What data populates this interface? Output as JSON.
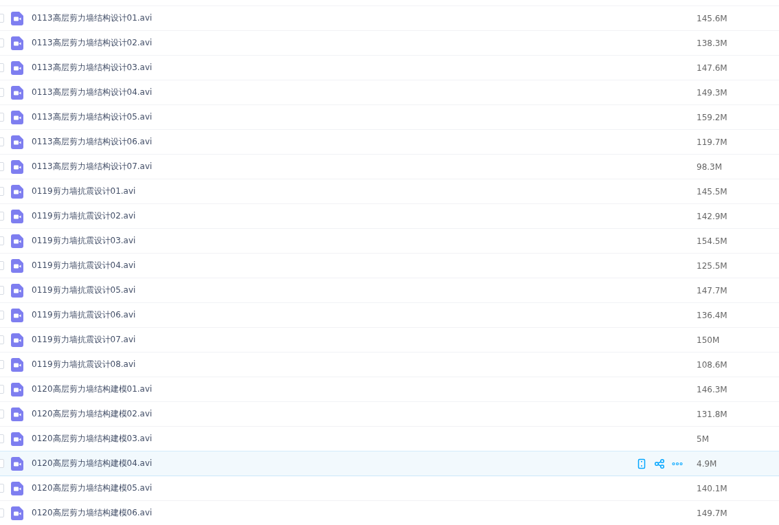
{
  "files": [
    {
      "name": "0113高层剪力墙结构设计01.avi",
      "size": "145.6M",
      "checked": false,
      "hovered": false
    },
    {
      "name": "0113高层剪力墙结构设计02.avi",
      "size": "138.3M",
      "checked": false,
      "hovered": false
    },
    {
      "name": "0113高层剪力墙结构设计03.avi",
      "size": "147.6M",
      "checked": false,
      "hovered": false
    },
    {
      "name": "0113高层剪力墙结构设计04.avi",
      "size": "149.3M",
      "checked": false,
      "hovered": false
    },
    {
      "name": "0113高层剪力墙结构设计05.avi",
      "size": "159.2M",
      "checked": false,
      "hovered": false
    },
    {
      "name": "0113高层剪力墙结构设计06.avi",
      "size": "119.7M",
      "checked": false,
      "hovered": false
    },
    {
      "name": "0113高层剪力墙结构设计07.avi",
      "size": "98.3M",
      "checked": false,
      "hovered": false
    },
    {
      "name": "0119剪力墙抗震设计01.avi",
      "size": "145.5M",
      "checked": false,
      "hovered": false
    },
    {
      "name": "0119剪力墙抗震设计02.avi",
      "size": "142.9M",
      "checked": false,
      "hovered": false
    },
    {
      "name": "0119剪力墙抗震设计03.avi",
      "size": "154.5M",
      "checked": false,
      "hovered": false
    },
    {
      "name": "0119剪力墙抗震设计04.avi",
      "size": "125.5M",
      "checked": false,
      "hovered": false
    },
    {
      "name": "0119剪力墙抗震设计05.avi",
      "size": "147.7M",
      "checked": false,
      "hovered": false
    },
    {
      "name": "0119剪力墙抗震设计06.avi",
      "size": "136.4M",
      "checked": false,
      "hovered": false
    },
    {
      "name": "0119剪力墙抗震设计07.avi",
      "size": "150M",
      "checked": false,
      "hovered": false
    },
    {
      "name": "0119剪力墙抗震设计08.avi",
      "size": "108.6M",
      "checked": false,
      "hovered": false
    },
    {
      "name": "0120高层剪力墙结构建模01.avi",
      "size": "146.3M",
      "checked": false,
      "hovered": false
    },
    {
      "name": "0120高层剪力墙结构建模02.avi",
      "size": "131.8M",
      "checked": false,
      "hovered": false
    },
    {
      "name": "0120高层剪力墙结构建模03.avi",
      "size": "5M",
      "checked": false,
      "hovered": false
    },
    {
      "name": "0120高层剪力墙结构建模04.avi",
      "size": "4.9M",
      "checked": false,
      "hovered": true
    },
    {
      "name": "0120高层剪力墙结构建模05.avi",
      "size": "140.1M",
      "checked": false,
      "hovered": false
    },
    {
      "name": "0120高层剪力墙结构建模06.avi",
      "size": "149.7M",
      "checked": false,
      "hovered": false
    }
  ]
}
